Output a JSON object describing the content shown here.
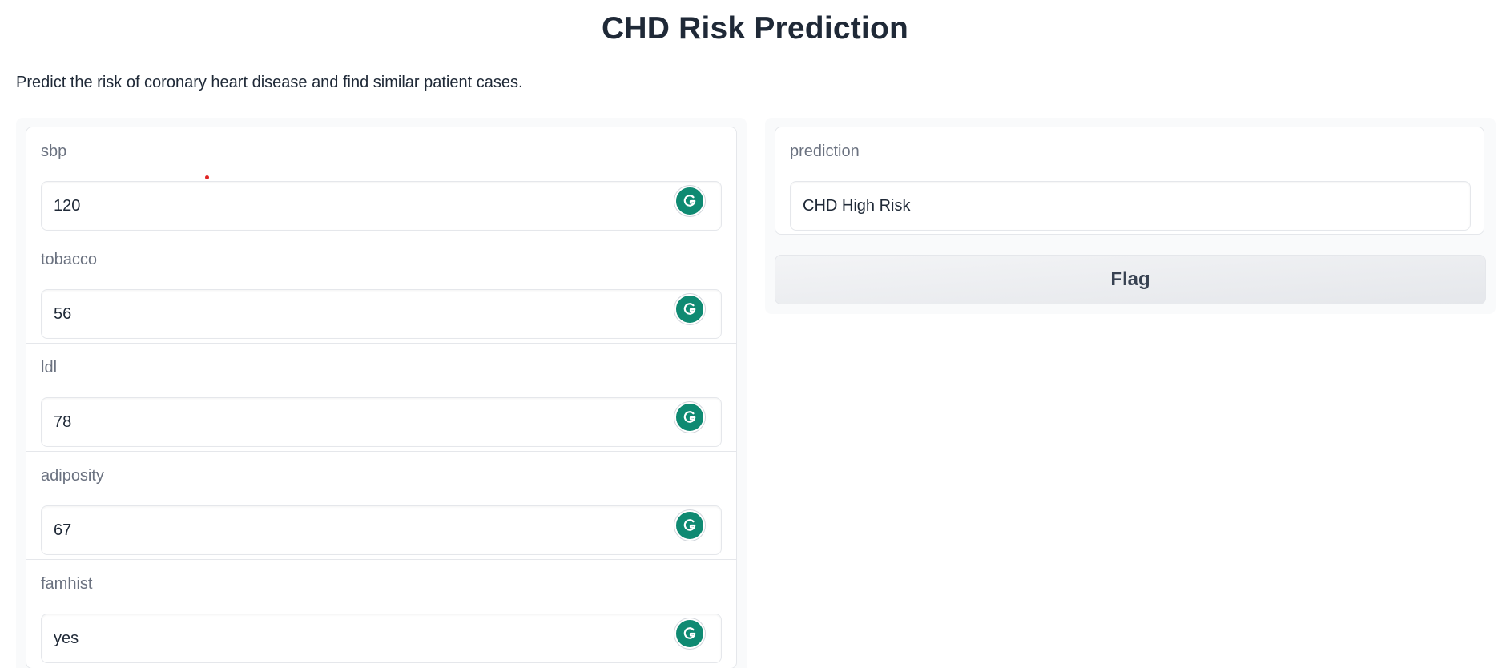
{
  "app": {
    "title": "CHD Risk Prediction",
    "description": "Predict the risk of coronary heart disease and find similar patient cases."
  },
  "inputs": [
    {
      "label": "sbp",
      "value": "120"
    },
    {
      "label": "tobacco",
      "value": "56"
    },
    {
      "label": "ldl",
      "value": "78"
    },
    {
      "label": "adiposity",
      "value": "67"
    },
    {
      "label": "famhist",
      "value": "yes"
    }
  ],
  "output": {
    "label": "prediction",
    "value": "CHD High Risk"
  },
  "actions": {
    "flag_label": "Flag"
  },
  "icons": {
    "input_assistant": "grammarly-icon"
  },
  "colors": {
    "grammarly": "#0f8a72",
    "panel_bg": "#f9fafb",
    "border": "#e5e7eb",
    "label": "#6b7280",
    "text": "#1f2937"
  }
}
